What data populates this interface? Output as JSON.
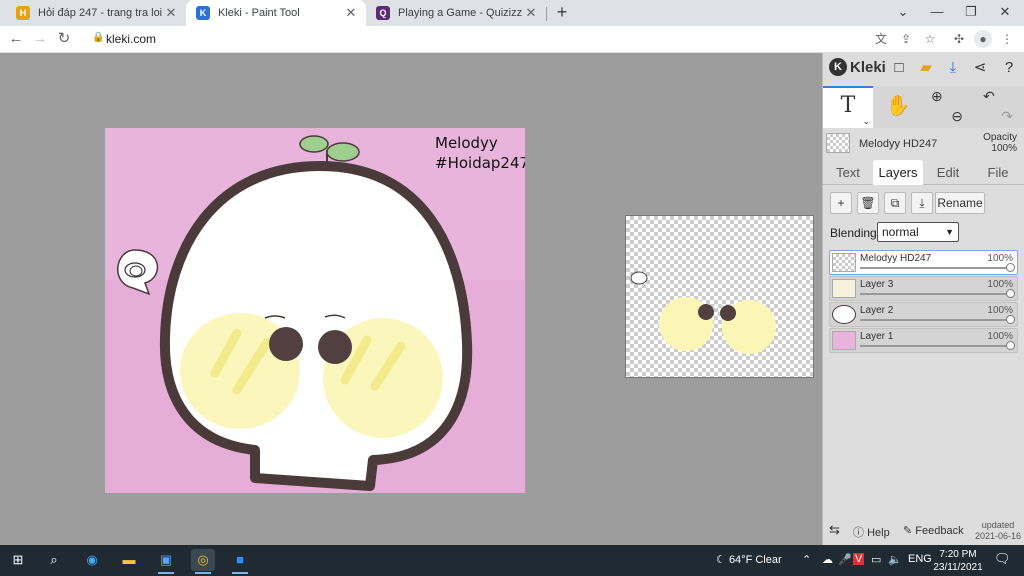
{
  "browser": {
    "tabs": [
      {
        "title": "Hỏi đáp 247 - trang tra loi",
        "icon": "hoidap-favicon",
        "color": "#e8a21a"
      },
      {
        "title": "Kleki - Paint Tool",
        "icon": "kleki-favicon",
        "color": "#2a72d8"
      },
      {
        "title": "Playing a Game - Quizizz",
        "icon": "quizizz-favicon",
        "color": "#5b2b74"
      }
    ],
    "new_tab": "+",
    "url": "kleki.com"
  },
  "canvas": {
    "signature_line1": "Melodyy",
    "signature_line2": "#Hoidap247",
    "background_color": "#e8b4dc",
    "blush_color": "#fbf6b5",
    "outline_color": "#4b3a3a"
  },
  "kleki": {
    "logo": "Kleki",
    "current_layer_name": "Melodyy HD247",
    "opacity_label": "Opacity",
    "opacity_value": "100%",
    "tabs": [
      "Text",
      "Layers",
      "Edit",
      "File"
    ],
    "active_tab": "Layers",
    "rename_label": "Rename",
    "blending_label": "Blending",
    "blending_value": "normal",
    "layers": [
      {
        "name": "Melodyy HD247",
        "opacity": "100%",
        "selected": true
      },
      {
        "name": "Layer 3",
        "opacity": "100%",
        "selected": false
      },
      {
        "name": "Layer 2",
        "opacity": "100%",
        "selected": false
      },
      {
        "name": "Layer 1",
        "opacity": "100%",
        "selected": false
      }
    ],
    "help_label": "Help",
    "feedback_label": "Feedback",
    "updated_label": "updated",
    "updated_date": "2021-06-16"
  },
  "taskbar": {
    "weather": "64°F  Clear",
    "language": "ENG",
    "time": "7:20 PM",
    "date": "23/11/2021"
  }
}
